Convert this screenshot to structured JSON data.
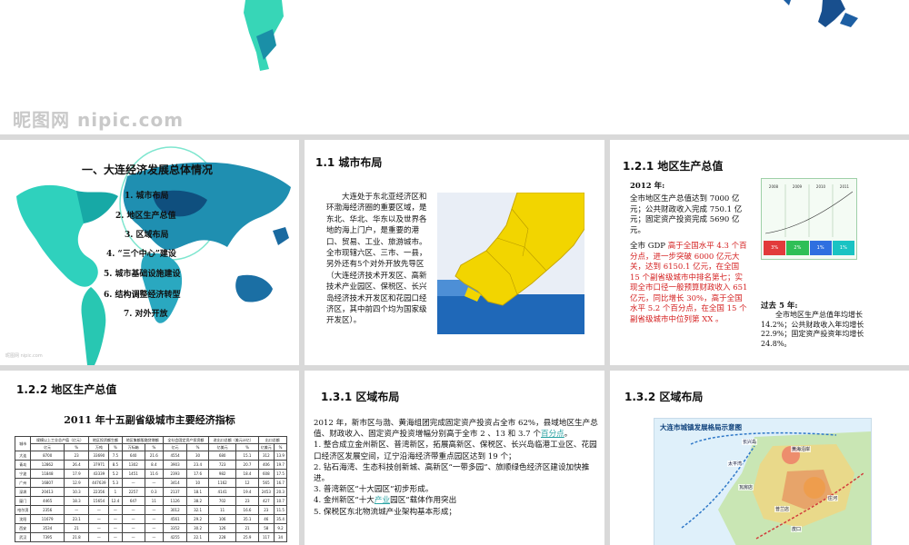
{
  "watermark": "昵图网 nipic.com",
  "small_watermark": "昵图网 nipic.com",
  "slide1": {
    "title": "一、大连经济发展总体情况",
    "items": [
      "1. 城市布局",
      "2. 地区生产总值",
      "3. 区域布局",
      "4. “三个中心”建设",
      "5. 城市基础设施建设",
      "6. 结构调整经济转型",
      "7. 对外开放"
    ]
  },
  "slide2": {
    "title": "1.1 城市布局",
    "body": "大连处于东北亚经济区和环渤海经济圈的重要区域，是东北、华北、华东以及世界各地的海上门户，是重要的港口、贸易、工业、旅游城市。全市现辖六区、三市、一县，另外还有5个对外开放先导区（大连经济技术开发区、高新技术产业园区、保税区、长兴岛经济技术开发区和花园口经济区，其中前四个均为国家级开发区）。"
  },
  "slide3": {
    "title": "1.2.1 地区生产总值",
    "year": "2012 年:",
    "p1": "全市地区生产总值达到 7000 亿元；公共财政收入完成 750.1 亿元；固定资产投资完成 5690 亿元。",
    "p2_lead": "全市 GDP ",
    "p2_red": "高于全国水平 4.3 个百分点，进一步突破 6000 亿元大关，达到 6150.1 亿元，在全国 15 个副省级城市中排名第七；实现全市口径一般预算财政收入 651 亿元，同比增长 30%，高于全国水平 5.2 个百分点，在全国 15 个副省级城市中位列第 XX 。",
    "past_title": "过去 5 年:",
    "past_body": "全市地区生产总值年均增长 14.2%；公共财政收入年均增长 22.9%；固定资产投资年均增长 24.8%。",
    "mini_chart": {
      "years": [
        "2008",
        "2009",
        "2010",
        "2011"
      ],
      "cells": [
        "3%",
        "2%",
        "1%",
        "1%"
      ],
      "cell_colors": [
        "#e23b3b",
        "#2fbf57",
        "#2f6fe0",
        "#19c3c3"
      ]
    }
  },
  "slide4": {
    "title": "1.2.2 地区生产总值",
    "subtitle": "2011 年十五副省级城市主要经济指标",
    "col_groups": [
      "城市",
      "规模以上工业总产值（亿元）",
      "地区投资额生额",
      "地区集额股融贷增额",
      "全社会固定资产投资额",
      "进出口总额（美元计亿）",
      "出口总额"
    ],
    "sub_cols": [
      "亿元",
      "%",
      "万吨",
      "%",
      "万标箱",
      "%",
      "亿元",
      "%",
      "亿美元",
      "%",
      "亿美元",
      "%"
    ],
    "rows": [
      [
        "大连",
        "8700",
        "23",
        "33690",
        "7.5",
        "640",
        "21.6",
        "4554",
        "30",
        "680",
        "15.1",
        "312",
        "13.9"
      ],
      [
        "青岛",
        "12862",
        "26.4",
        "37971",
        "8.5",
        "1302",
        "8.4",
        "3903",
        "23.4",
        "723",
        "20.7",
        "406",
        "19.7"
      ],
      [
        "宁波",
        "11848",
        "17.9",
        "43339",
        "5.2",
        "1451",
        "11.6",
        "2393",
        "17.6",
        "982",
        "18.4",
        "608",
        "17.5"
      ],
      [
        "广州",
        "16807",
        "12.9",
        "447639",
        "5.3",
        "—",
        "—",
        "3414",
        "10",
        "1162",
        "12",
        "565",
        "16.7"
      ],
      [
        "深圳",
        "20413",
        "10.3",
        "22356",
        "1",
        "2257",
        "0.3",
        "2137",
        "18.1",
        "4141",
        "19.4",
        "2453",
        "20.3"
      ],
      [
        "厦门",
        "4465",
        "18.3",
        "15654",
        "12.4",
        "647",
        "11",
        "1126",
        "38.2",
        "702",
        "23",
        "427",
        "10.7"
      ],
      [
        "哈尔滨",
        "2356",
        "—",
        "—",
        "—",
        "—",
        "—",
        "3012",
        "32.1",
        "11",
        "16.6",
        "23",
        "11.5"
      ],
      [
        "沈阳",
        "11679",
        "23.1",
        "—",
        "—",
        "—",
        "—",
        "4561",
        "29.2",
        "106",
        "35.1",
        "46",
        "35.4"
      ],
      [
        "西安",
        "3534",
        "21",
        "—",
        "—",
        "—",
        "—",
        "3352",
        "30.2",
        "126",
        "21",
        "58",
        "9.2"
      ],
      [
        "武汉",
        "7395",
        "21.8",
        "—",
        "—",
        "—",
        "—",
        "4255",
        "22.1",
        "228",
        "25.9",
        "117",
        "34"
      ]
    ]
  },
  "slide5": {
    "title": "1.3.1 区域布局",
    "intro": "2012 年，新市区与渤、黄海组团完成固定资产投资占全市 62%，县域地区生产总值、财政收入、固定资产投资增幅分别高于全市 2 、13 和 3.7 个",
    "intro_link": "百分点",
    "intro_end": "。",
    "points": [
      "1. 整合成立金州新区、普湾新区，拓展高新区、保税区、长兴岛临港工业区、花园口经济区发展空间，辽宁沿海经济带重点园区达到 19 个；",
      "2. 钻石海湾、生态科技创新城、高新区“一带多园”、旅顺绿色经济区建设加快推进。",
      "3. 普湾新区“十大园区”初步形成。"
    ],
    "point4_lead": "4. 金州新区“十大",
    "point4_link": "产业",
    "point4_end": "园区”载体作用突出",
    "point5": "5. 保税区东北物流城产业架构基本形成；"
  },
  "slide6": {
    "title": "1.3.2 区域布局",
    "map_title": "大连市城镇发展格局示意图",
    "map_labels": [
      "长兴岛",
      "太平湾",
      "瓦房店",
      "普兰店",
      "皮口",
      "庄河",
      "黄海沿岸"
    ]
  }
}
